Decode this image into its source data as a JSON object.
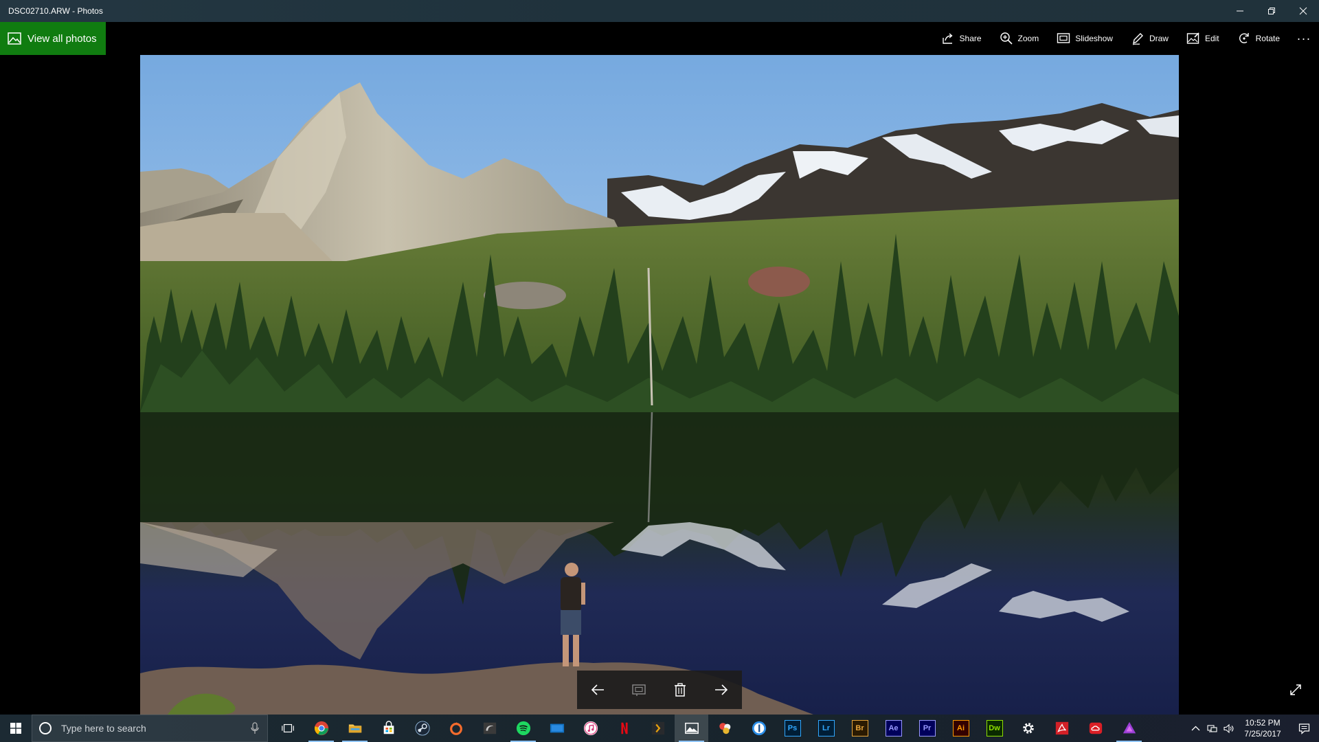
{
  "window": {
    "title": "DSC02710.ARW - Photos"
  },
  "toolbar": {
    "view_all_label": "View all photos",
    "share_label": "Share",
    "zoom_label": "Zoom",
    "slideshow_label": "Slideshow",
    "draw_label": "Draw",
    "edit_label": "Edit",
    "rotate_label": "Rotate",
    "more_label": "···"
  },
  "photo": {
    "subject": "mountain-lake-reflection"
  },
  "nav": {
    "items": [
      "previous-arrow-icon",
      "add-to-album-icon",
      "delete-icon",
      "next-arrow-icon"
    ]
  },
  "taskbar": {
    "search_placeholder": "Type here to search",
    "apps": [
      {
        "name": "task-view"
      },
      {
        "name": "chrome",
        "open": true
      },
      {
        "name": "file-explorer",
        "open": true
      },
      {
        "name": "store"
      },
      {
        "name": "steam"
      },
      {
        "name": "origin"
      },
      {
        "name": "geforce-experience"
      },
      {
        "name": "spotify",
        "open": true
      },
      {
        "name": "movies-tv"
      },
      {
        "name": "itunes"
      },
      {
        "name": "netflix"
      },
      {
        "name": "plex"
      },
      {
        "name": "photos",
        "open": true,
        "active": true
      },
      {
        "name": "davinci-resolve"
      },
      {
        "name": "1password"
      },
      {
        "name": "photoshop",
        "label": "Ps"
      },
      {
        "name": "lightroom",
        "label": "Lr"
      },
      {
        "name": "bridge",
        "label": "Br"
      },
      {
        "name": "after-effects",
        "label": "Ae"
      },
      {
        "name": "premiere",
        "label": "Pr"
      },
      {
        "name": "illustrator",
        "label": "Ai"
      },
      {
        "name": "dreamweaver",
        "label": "Dw"
      },
      {
        "name": "settings"
      },
      {
        "name": "acrobat"
      },
      {
        "name": "creative-cloud"
      },
      {
        "name": "affinity",
        "open": true
      }
    ],
    "clock_time": "10:52 PM",
    "clock_date": "7/25/2017"
  },
  "colors": {
    "accent_green": "#107c10",
    "photoshop": "#31a8ff",
    "lightroom": "#31a8ff",
    "bridge": "#e8a53a",
    "after_effects": "#9999ff",
    "premiere": "#9999ff",
    "illustrator": "#ff9a00",
    "dreamweaver": "#8fe000"
  }
}
